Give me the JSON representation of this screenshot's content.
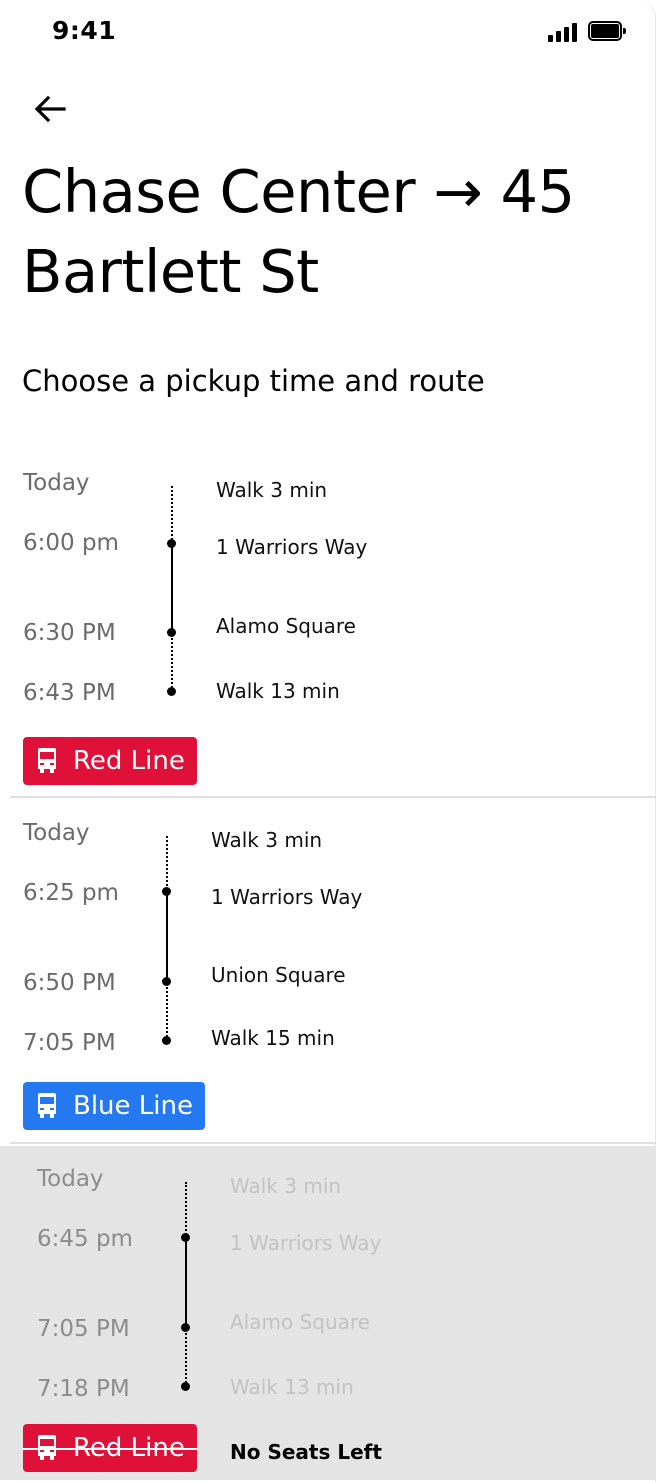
{
  "status_bar": {
    "time": "9:41"
  },
  "header": {
    "title": "Chase Center → 45 Bartlett St",
    "subtitle": "Choose a pickup time and route"
  },
  "routes": [
    {
      "day": "Today",
      "depart": "6:00 pm",
      "mid_time": "6:30 PM",
      "arrive": "6:43 PM",
      "walk_start": "Walk 3 min",
      "pickup": "1 Warriors Way",
      "dropoff": "Alamo Square",
      "walk_end": "Walk 13 min",
      "line": "Red Line",
      "line_color": "#df1139",
      "available": true
    },
    {
      "day": "Today",
      "depart": "6:25 pm",
      "mid_time": "6:50 PM",
      "arrive": "7:05 PM",
      "walk_start": "Walk 3 min",
      "pickup": "1 Warriors Way",
      "dropoff": "Union Square",
      "walk_end": "Walk 15 min",
      "line": "Blue Line",
      "line_color": "#2478f0",
      "available": true
    },
    {
      "day": "Today",
      "depart": "6:45 pm",
      "mid_time": "7:05 PM",
      "arrive": "7:18 PM",
      "walk_start": "Walk 3 min",
      "pickup": "1 Warriors Way",
      "dropoff": "Alamo Square",
      "walk_end": "Walk 13 min",
      "line": "Red Line",
      "line_color": "#df1139",
      "available": false,
      "status": "No Seats Left"
    }
  ],
  "icons": {
    "back": "arrow-left-icon",
    "bus": "bus-icon",
    "signal": "cellular-signal-icon",
    "battery": "battery-icon"
  }
}
